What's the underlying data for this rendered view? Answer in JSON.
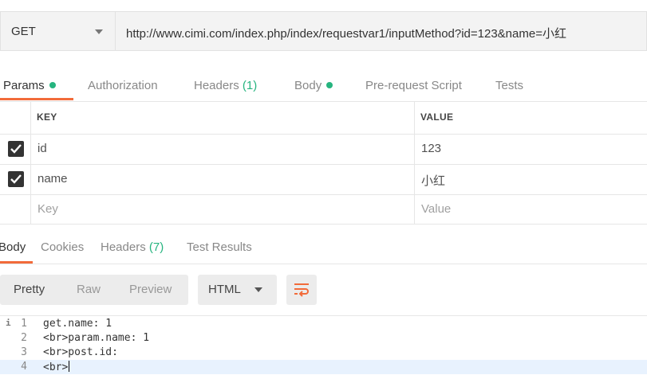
{
  "request": {
    "method": "GET",
    "url": "http://www.cimi.com/index.php/index/requestvar1/inputMethod?id=123&name=小红"
  },
  "request_tabs": [
    {
      "label": "Params",
      "active": true,
      "dot": true
    },
    {
      "label": "Authorization"
    },
    {
      "label": "Headers",
      "count": "(1)"
    },
    {
      "label": "Body",
      "dot": true
    },
    {
      "label": "Pre-request Script"
    },
    {
      "label": "Tests"
    }
  ],
  "params": {
    "headers": {
      "key": "KEY",
      "value": "VALUE"
    },
    "rows": [
      {
        "checked": true,
        "key": "id",
        "value": "123"
      },
      {
        "checked": true,
        "key": "name",
        "value": "小红"
      }
    ],
    "placeholder": {
      "key": "Key",
      "value": "Value"
    }
  },
  "response_tabs": [
    {
      "label": "Body",
      "active": true
    },
    {
      "label": "Cookies"
    },
    {
      "label": "Headers",
      "count": "(7)"
    },
    {
      "label": "Test Results"
    }
  ],
  "toolbar": {
    "view_modes": [
      "Pretty",
      "Raw",
      "Preview"
    ],
    "format": "HTML",
    "wrap_icon": "wrap-lines-icon"
  },
  "code": {
    "lines": [
      {
        "num": "1",
        "text": "get.name: 1"
      },
      {
        "num": "2",
        "text": "<br>param.name: 1"
      },
      {
        "num": "3",
        "text": "<br>post.id:"
      },
      {
        "num": "4",
        "text": "<br>"
      }
    ],
    "info_marker": "i"
  },
  "colors": {
    "accent": "#f26b3a",
    "status_green": "#26b47f",
    "checkbox": "#333333"
  }
}
